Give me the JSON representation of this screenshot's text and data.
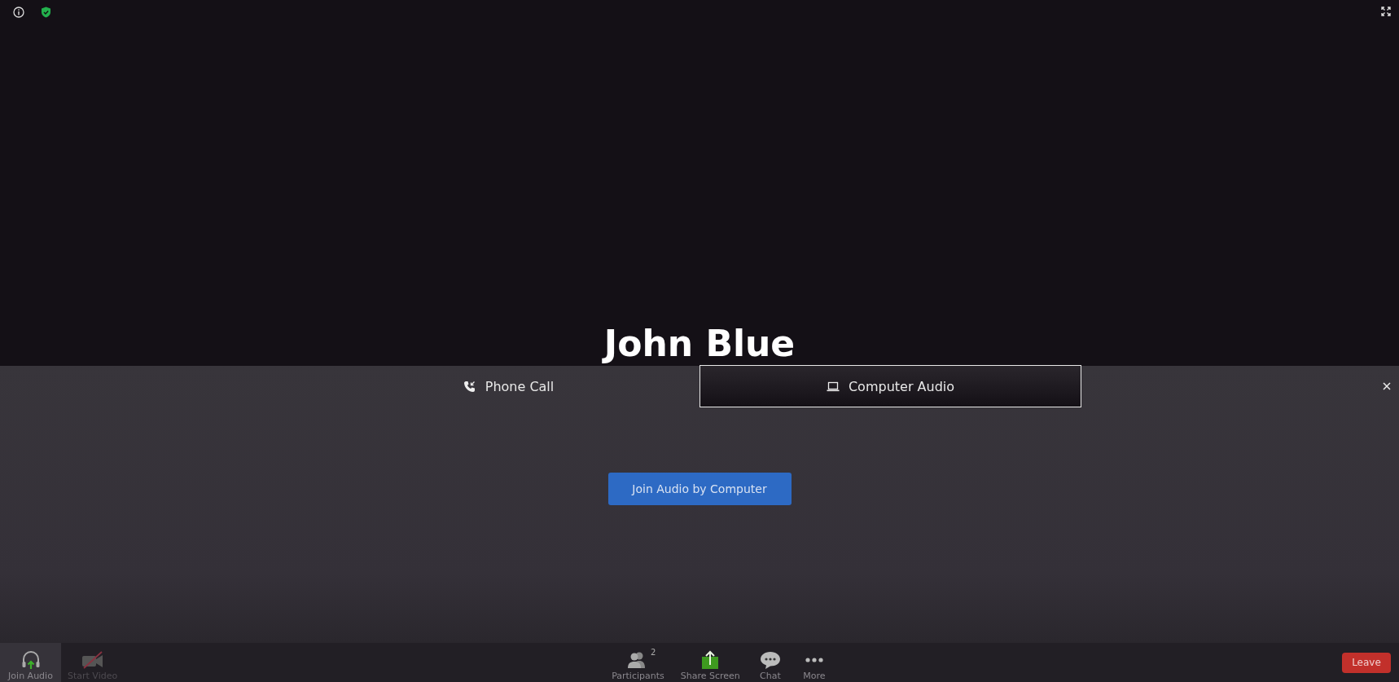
{
  "participant_name": "John Blue",
  "audio_panel": {
    "tabs": [
      {
        "kind": "phone",
        "label": "Phone Call",
        "selected": false
      },
      {
        "kind": "computer",
        "label": "Computer Audio",
        "selected": true
      }
    ],
    "join_button": "Join Audio by Computer"
  },
  "toolbar": {
    "left": [
      {
        "kind": "audio",
        "label": "Join Audio",
        "highlighted": true,
        "disabled": false
      },
      {
        "kind": "video",
        "label": "Start Video",
        "highlighted": false,
        "disabled": true
      }
    ],
    "center": [
      {
        "kind": "participants",
        "label": "Participants",
        "badge": "2"
      },
      {
        "kind": "share",
        "label": "Share Screen"
      },
      {
        "kind": "chat",
        "label": "Chat"
      },
      {
        "kind": "more",
        "label": "More"
      }
    ],
    "leave": "Leave"
  }
}
